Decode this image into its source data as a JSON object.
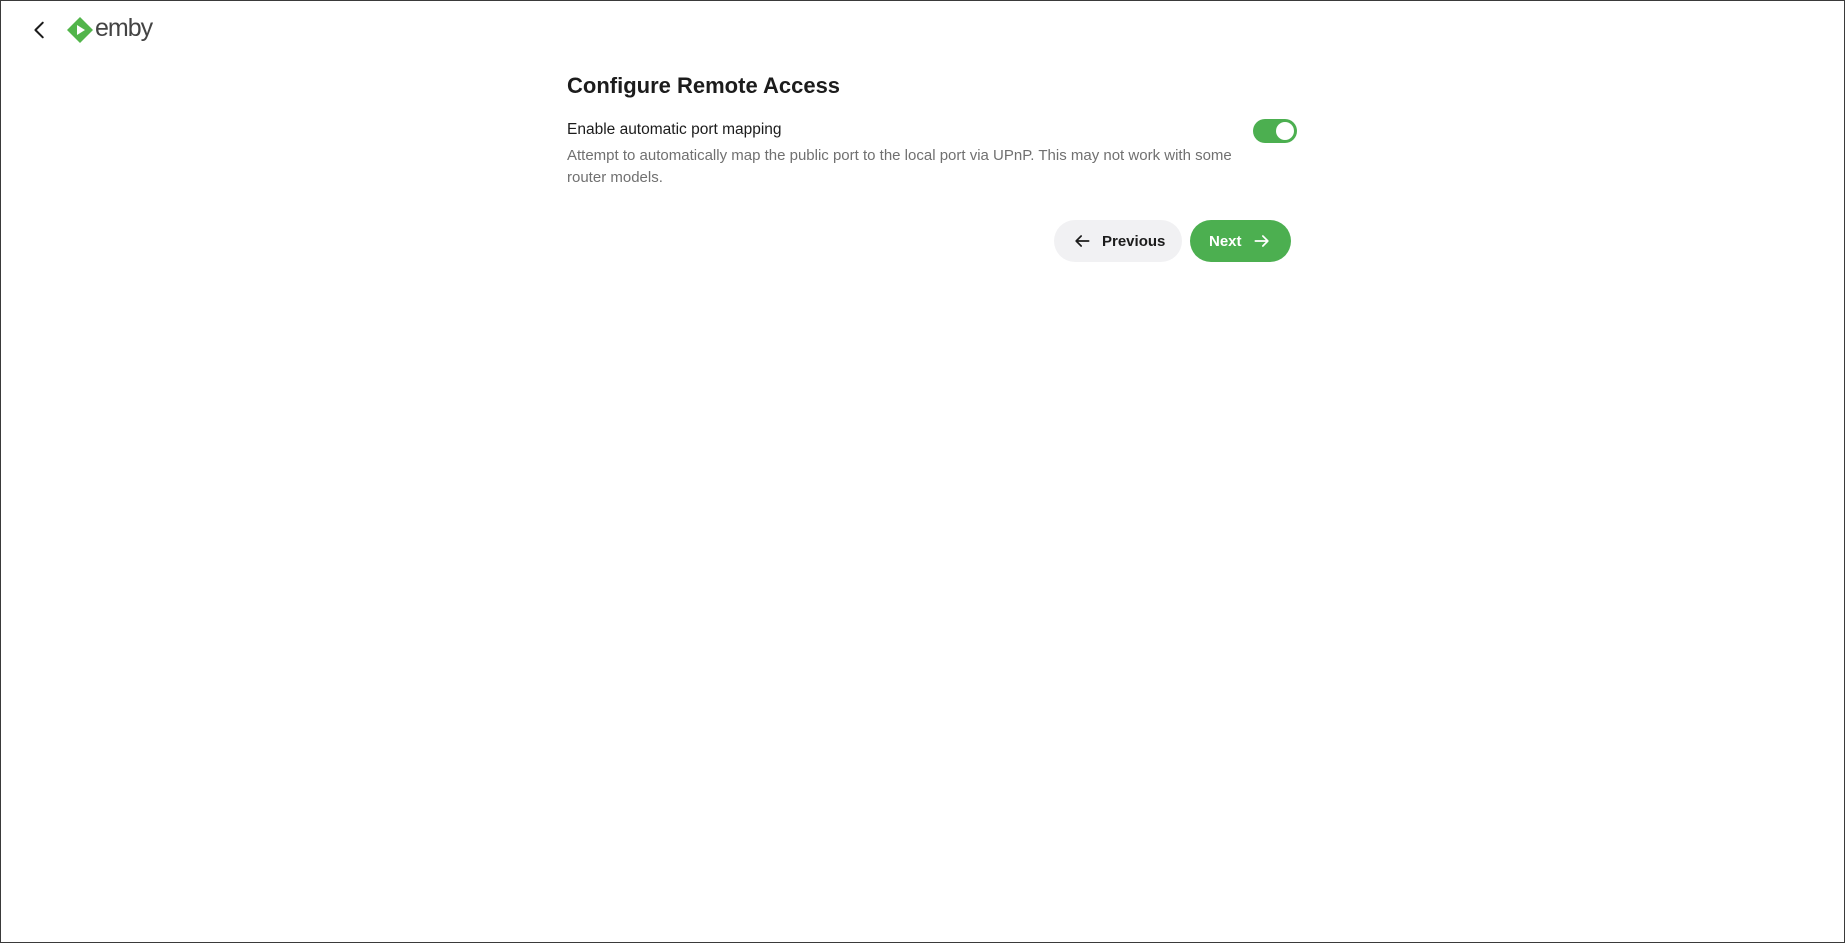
{
  "header": {
    "back_icon": "chevron-left-icon",
    "logo_text": "emby",
    "logo_color": "#52b54b"
  },
  "main": {
    "title": "Configure Remote Access",
    "setting": {
      "label": "Enable automatic port mapping",
      "description": "Attempt to automatically map the public port to the local port via UPnP. This may not work with some router models.",
      "enabled": true
    },
    "buttons": {
      "previous_label": "Previous",
      "previous_icon": "arrow-left-icon",
      "next_label": "Next",
      "next_icon": "arrow-right-icon"
    }
  },
  "colors": {
    "accent": "#4caf50",
    "secondary_button_bg": "#f1f1f3",
    "description_text": "#707070"
  }
}
